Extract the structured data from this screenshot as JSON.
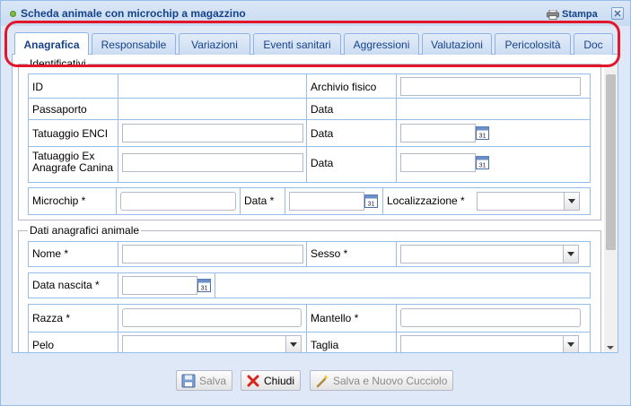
{
  "window": {
    "title": "Scheda animale con microchip a magazzino",
    "print_label": "Stampa"
  },
  "tabs": [
    {
      "label": "Anagrafica",
      "active": true
    },
    {
      "label": "Responsabile",
      "active": false
    },
    {
      "label": "Variazioni",
      "active": false
    },
    {
      "label": "Eventi sanitari",
      "active": false
    },
    {
      "label": "Aggressioni",
      "active": false
    },
    {
      "label": "Valutazioni",
      "active": false
    },
    {
      "label": "Pericolosità",
      "active": false
    },
    {
      "label": "Doc",
      "active": false
    }
  ],
  "identificativi": {
    "legend": "Identificativi",
    "id_label": "ID",
    "id_value": "",
    "archivio_label": "Archivio fisico",
    "archivio_value": "",
    "passaporto_label": "Passaporto",
    "passaporto_data_label": "Data",
    "tatuaggio_enci_label": "Tatuaggio ENCI",
    "tatuaggio_enci_value": "",
    "tatuaggio_enci_data_label": "Data",
    "tatuaggio_enci_date": "",
    "tatuaggio_ex_label_1": "Tatuaggio Ex",
    "tatuaggio_ex_label_2": "Anagrafe Canina",
    "tatuaggio_ex_value": "",
    "tatuaggio_ex_data_label": "Data",
    "tatuaggio_ex_date": "",
    "microchip_label": "Microchip *",
    "microchip_value": "",
    "microchip_data_label": "Data *",
    "microchip_date": "",
    "localizzazione_label": "Localizzazione *",
    "localizzazione_value": ""
  },
  "dati_anagrafici": {
    "legend": "Dati anagrafici animale",
    "nome_label": "Nome *",
    "nome_value": "",
    "sesso_label": "Sesso *",
    "sesso_value": "",
    "data_nascita_label": "Data nascita *",
    "data_nascita_value": "",
    "razza_label": "Razza *",
    "razza_value": "",
    "mantello_label": "Mantello *",
    "mantello_value": "",
    "pelo_label": "Pelo",
    "pelo_value": "",
    "taglia_label": "Taglia",
    "taglia_value": ""
  },
  "footer": {
    "salva": "Salva",
    "chiudi": "Chiudi",
    "salva_nuovo": "Salva e Nuovo Cucciolo"
  },
  "calendar_icon_text": "31",
  "colors": {
    "title_text": "#15428b",
    "highlight": "#e3172b",
    "border": "#99bbe8"
  }
}
